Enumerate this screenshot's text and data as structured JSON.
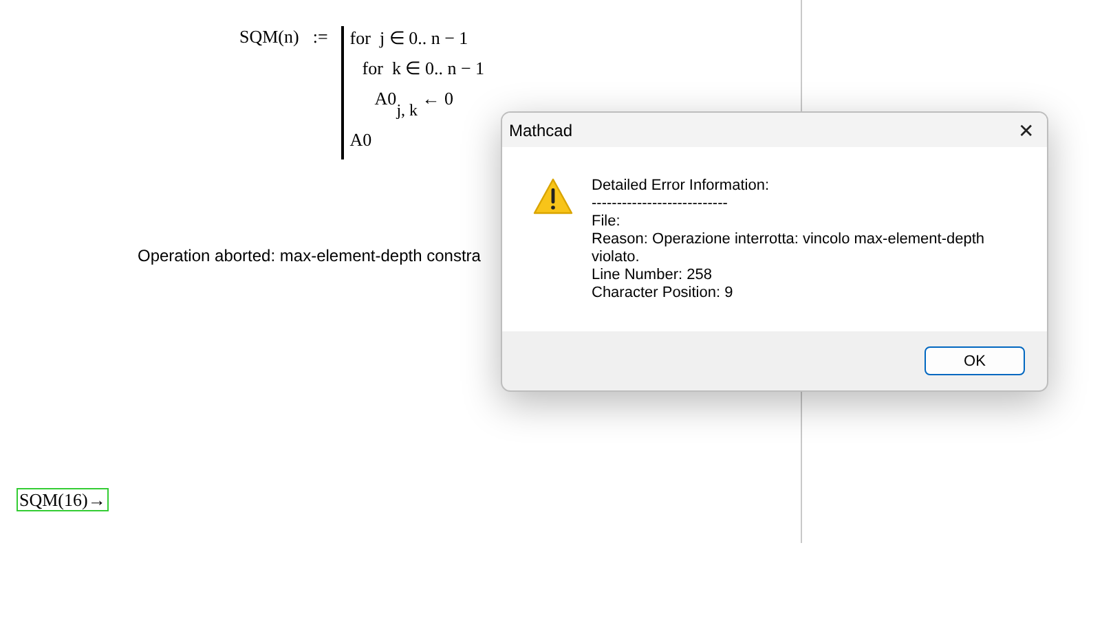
{
  "worksheet": {
    "definition": {
      "name": "SQM(n)",
      "operator": ":=",
      "program": [
        {
          "kind": "line",
          "text": "for  j ∈ 0.. n − 1",
          "children": [
            {
              "kind": "line",
              "text": "for  k ∈ 0.. n − 1",
              "children": [
                {
                  "kind": "line",
                  "text": "A0$_{j, k}$ ← 0"
                }
              ]
            }
          ]
        },
        {
          "kind": "line",
          "text": "A0"
        }
      ]
    },
    "error_text": "Operation aborted: max-element-depth constra",
    "evaluation": {
      "text": "SQM(16)→",
      "selected": true
    }
  },
  "dialog": {
    "title": "Mathcad",
    "close": "✕",
    "lines": [
      "Detailed Error Information:",
      "---------------------------",
      "File:",
      "Reason: Operazione interrotta: vincolo max-element-depth violato.",
      "Line Number: 258",
      "Character Position: 9"
    ],
    "buttons": [
      "OK"
    ]
  }
}
